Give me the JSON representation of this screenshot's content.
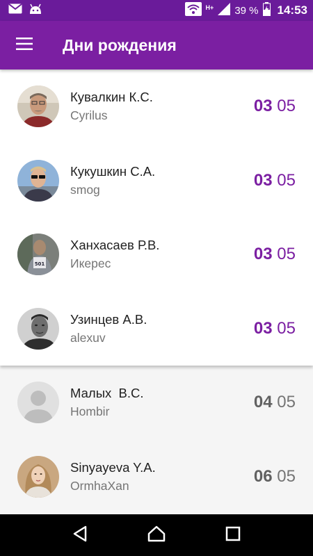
{
  "status_bar": {
    "notification_icons": [
      "mail-icon",
      "android-icon"
    ],
    "network_label": "H+",
    "battery_percent": "39 %",
    "time": "14:53"
  },
  "app_bar": {
    "title": "Дни рождения",
    "menu_icon": "hamburger-menu-icon",
    "color": "#7b1fa2"
  },
  "birthdays_current": [
    {
      "name": "Кувалкин К.С.",
      "nick": "Cyrilus",
      "day": "03",
      "month": "05"
    },
    {
      "name": "Кукушкин С.А.",
      "nick": "smog",
      "day": "03",
      "month": "05"
    },
    {
      "name": "Ханхасаев Р.В.",
      "nick": "Икерес",
      "day": "03",
      "month": "05"
    },
    {
      "name": "Узинцев А.В.",
      "nick": "alexuv",
      "day": "03",
      "month": "05"
    }
  ],
  "birthdays_upcoming": [
    {
      "name": "Малых  В.С.",
      "nick": "Hombir",
      "day": "04",
      "month": "05"
    },
    {
      "name": "Sinyayeva Y.A.",
      "nick": "OrmhaXan",
      "day": "06",
      "month": "05"
    }
  ],
  "nav_bar": {
    "buttons": [
      "back-icon",
      "home-icon",
      "recents-icon"
    ]
  },
  "colors": {
    "accent": "#7b1fa2",
    "status_bar": "#6a1b9a",
    "current_date": "#7b1fa2",
    "upcoming_date": "#616161"
  }
}
